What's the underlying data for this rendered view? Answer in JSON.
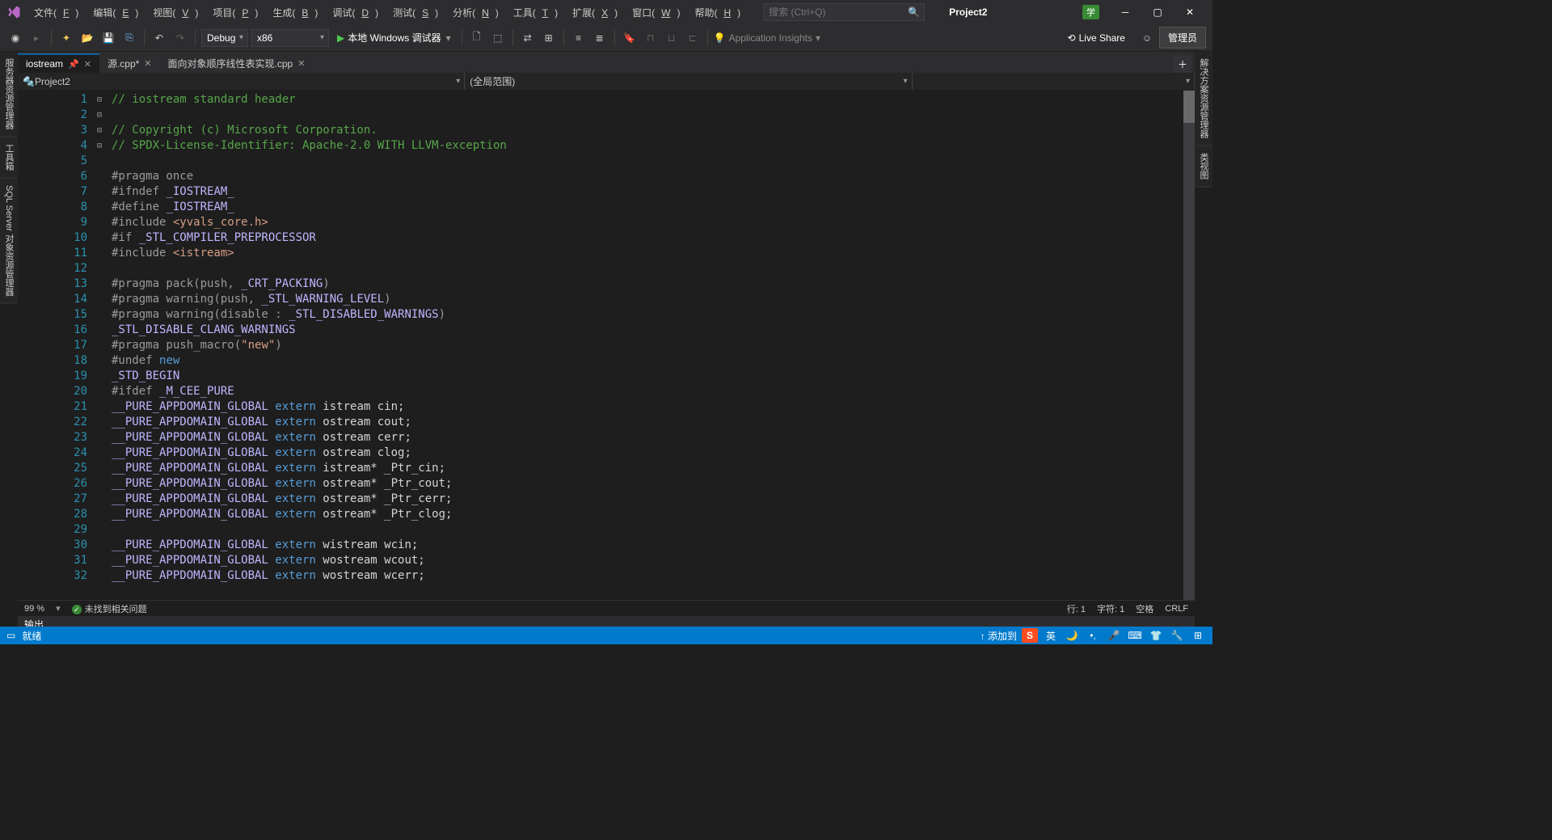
{
  "menus": [
    "文件(F)",
    "编辑(E)",
    "视图(V)",
    "项目(P)",
    "生成(B)",
    "调试(D)",
    "测试(S)",
    "分析(N)",
    "工具(T)",
    "扩展(X)",
    "窗口(W)",
    "帮助(H)"
  ],
  "search": {
    "placeholder": "搜索 (Ctrl+Q)"
  },
  "project_name": "Project2",
  "badge": "学",
  "toolbar": {
    "config": "Debug",
    "platform": "x86",
    "debugger": "本地 Windows 调试器",
    "insights": "Application Insights",
    "liveshare": "Live Share",
    "admin": "管理员"
  },
  "sideleft": [
    "服务器资源管理器",
    "工具箱",
    "SQL Server 对象资源管理器"
  ],
  "sideright": [
    "解决方案资源管理器",
    "类视图"
  ],
  "tabs": [
    {
      "label": "iostream",
      "active": true,
      "pinned": true
    },
    {
      "label": "源.cpp*",
      "active": false
    },
    {
      "label": "面向对象顺序线性表实现.cpp",
      "active": false
    }
  ],
  "nav": {
    "left": "Project2",
    "mid": "(全局范围)",
    "right": ""
  },
  "status": {
    "zoom": "99 %",
    "issues": "未找到相关问题",
    "line": "行: 1",
    "col": "字符: 1",
    "ins": "空格",
    "eol": "CRLF"
  },
  "output_label": "输出",
  "bluebar": {
    "ready": "就绪",
    "add": "↑ 添加到"
  },
  "code": [
    {
      "n": 1,
      "f": "",
      "segs": [
        {
          "t": "// iostream standard header",
          "c": "c-green"
        }
      ]
    },
    {
      "n": 2,
      "f": "",
      "segs": []
    },
    {
      "n": 3,
      "f": "⊟",
      "segs": [
        {
          "t": "// Copyright (c) Microsoft Corporation.",
          "c": "c-green"
        }
      ]
    },
    {
      "n": 4,
      "f": "",
      "segs": [
        {
          "t": "// SPDX-License-Identifier: Apache-2.0 WITH LLVM-exception",
          "c": "c-green"
        }
      ]
    },
    {
      "n": 5,
      "f": "",
      "segs": []
    },
    {
      "n": 6,
      "f": "",
      "segs": [
        {
          "t": "#pragma once",
          "c": "c-gray"
        }
      ]
    },
    {
      "n": 7,
      "f": "⊟",
      "segs": [
        {
          "t": "#ifndef ",
          "c": "c-gray"
        },
        {
          "t": "_IOSTREAM_",
          "c": "c-purple"
        }
      ]
    },
    {
      "n": 8,
      "f": "",
      "segs": [
        {
          "t": "#define ",
          "c": "c-gray"
        },
        {
          "t": "_IOSTREAM_",
          "c": "c-purple"
        }
      ]
    },
    {
      "n": 9,
      "f": "",
      "segs": [
        {
          "t": "#include ",
          "c": "c-gray"
        },
        {
          "t": "<yvals_core.h>",
          "c": "c-str"
        }
      ]
    },
    {
      "n": 10,
      "f": "⊟",
      "segs": [
        {
          "t": "#if ",
          "c": "c-gray"
        },
        {
          "t": "_STL_COMPILER_PREPROCESSOR",
          "c": "c-purple"
        }
      ]
    },
    {
      "n": 11,
      "f": "",
      "segs": [
        {
          "t": "#include ",
          "c": "c-gray"
        },
        {
          "t": "<istream>",
          "c": "c-str"
        }
      ]
    },
    {
      "n": 12,
      "f": "",
      "segs": []
    },
    {
      "n": 13,
      "f": "",
      "segs": [
        {
          "t": "#pragma pack(push, ",
          "c": "c-gray"
        },
        {
          "t": "_CRT_PACKING",
          "c": "c-purple"
        },
        {
          "t": ")",
          "c": "c-gray"
        }
      ]
    },
    {
      "n": 14,
      "f": "",
      "segs": [
        {
          "t": "#pragma warning(push, ",
          "c": "c-gray"
        },
        {
          "t": "_STL_WARNING_LEVEL",
          "c": "c-purple"
        },
        {
          "t": ")",
          "c": "c-gray"
        }
      ]
    },
    {
      "n": 15,
      "f": "",
      "segs": [
        {
          "t": "#pragma warning(disable : ",
          "c": "c-gray"
        },
        {
          "t": "_STL_DISABLED_WARNINGS",
          "c": "c-purple"
        },
        {
          "t": ")",
          "c": "c-gray"
        }
      ]
    },
    {
      "n": 16,
      "f": "",
      "segs": [
        {
          "t": "_STL_DISABLE_CLANG_WARNINGS",
          "c": "c-purple"
        }
      ]
    },
    {
      "n": 17,
      "f": "",
      "segs": [
        {
          "t": "#pragma push_macro(",
          "c": "c-gray"
        },
        {
          "t": "\"new\"",
          "c": "c-str"
        },
        {
          "t": ")",
          "c": "c-gray"
        }
      ]
    },
    {
      "n": 18,
      "f": "",
      "segs": [
        {
          "t": "#undef ",
          "c": "c-gray"
        },
        {
          "t": "new",
          "c": "c-blue"
        }
      ]
    },
    {
      "n": 19,
      "f": "",
      "segs": [
        {
          "t": "_STD_BEGIN",
          "c": "c-purple"
        }
      ]
    },
    {
      "n": 20,
      "f": "⊟",
      "segs": [
        {
          "t": "#ifdef ",
          "c": "c-gray"
        },
        {
          "t": "_M_CEE_PURE",
          "c": "c-purple"
        }
      ]
    },
    {
      "n": 21,
      "f": "",
      "segs": [
        {
          "t": "__PURE_APPDOMAIN_GLOBAL ",
          "c": "c-purple"
        },
        {
          "t": "extern",
          "c": "c-blue"
        },
        {
          "t": " istream cin;",
          "c": ""
        }
      ]
    },
    {
      "n": 22,
      "f": "",
      "segs": [
        {
          "t": "__PURE_APPDOMAIN_GLOBAL ",
          "c": "c-purple"
        },
        {
          "t": "extern",
          "c": "c-blue"
        },
        {
          "t": " ostream cout;",
          "c": ""
        }
      ]
    },
    {
      "n": 23,
      "f": "",
      "segs": [
        {
          "t": "__PURE_APPDOMAIN_GLOBAL ",
          "c": "c-purple"
        },
        {
          "t": "extern",
          "c": "c-blue"
        },
        {
          "t": " ostream cerr;",
          "c": ""
        }
      ]
    },
    {
      "n": 24,
      "f": "",
      "segs": [
        {
          "t": "__PURE_APPDOMAIN_GLOBAL ",
          "c": "c-purple"
        },
        {
          "t": "extern",
          "c": "c-blue"
        },
        {
          "t": " ostream clog;",
          "c": ""
        }
      ]
    },
    {
      "n": 25,
      "f": "",
      "segs": [
        {
          "t": "__PURE_APPDOMAIN_GLOBAL ",
          "c": "c-purple"
        },
        {
          "t": "extern",
          "c": "c-blue"
        },
        {
          "t": " istream* _Ptr_cin;",
          "c": ""
        }
      ]
    },
    {
      "n": 26,
      "f": "",
      "segs": [
        {
          "t": "__PURE_APPDOMAIN_GLOBAL ",
          "c": "c-purple"
        },
        {
          "t": "extern",
          "c": "c-blue"
        },
        {
          "t": " ostream* _Ptr_cout;",
          "c": ""
        }
      ]
    },
    {
      "n": 27,
      "f": "",
      "segs": [
        {
          "t": "__PURE_APPDOMAIN_GLOBAL ",
          "c": "c-purple"
        },
        {
          "t": "extern",
          "c": "c-blue"
        },
        {
          "t": " ostream* _Ptr_cerr;",
          "c": ""
        }
      ]
    },
    {
      "n": 28,
      "f": "",
      "segs": [
        {
          "t": "__PURE_APPDOMAIN_GLOBAL ",
          "c": "c-purple"
        },
        {
          "t": "extern",
          "c": "c-blue"
        },
        {
          "t": " ostream* _Ptr_clog;",
          "c": ""
        }
      ]
    },
    {
      "n": 29,
      "f": "",
      "segs": []
    },
    {
      "n": 30,
      "f": "",
      "segs": [
        {
          "t": "__PURE_APPDOMAIN_GLOBAL ",
          "c": "c-purple"
        },
        {
          "t": "extern",
          "c": "c-blue"
        },
        {
          "t": " wistream wcin;",
          "c": ""
        }
      ]
    },
    {
      "n": 31,
      "f": "",
      "segs": [
        {
          "t": "__PURE_APPDOMAIN_GLOBAL ",
          "c": "c-purple"
        },
        {
          "t": "extern",
          "c": "c-blue"
        },
        {
          "t": " wostream wcout;",
          "c": ""
        }
      ]
    },
    {
      "n": 32,
      "f": "",
      "segs": [
        {
          "t": "__PURE_APPDOMAIN_GLOBAL ",
          "c": "c-purple"
        },
        {
          "t": "extern",
          "c": "c-blue"
        },
        {
          "t": " wostream wcerr;",
          "c": ""
        }
      ]
    }
  ]
}
